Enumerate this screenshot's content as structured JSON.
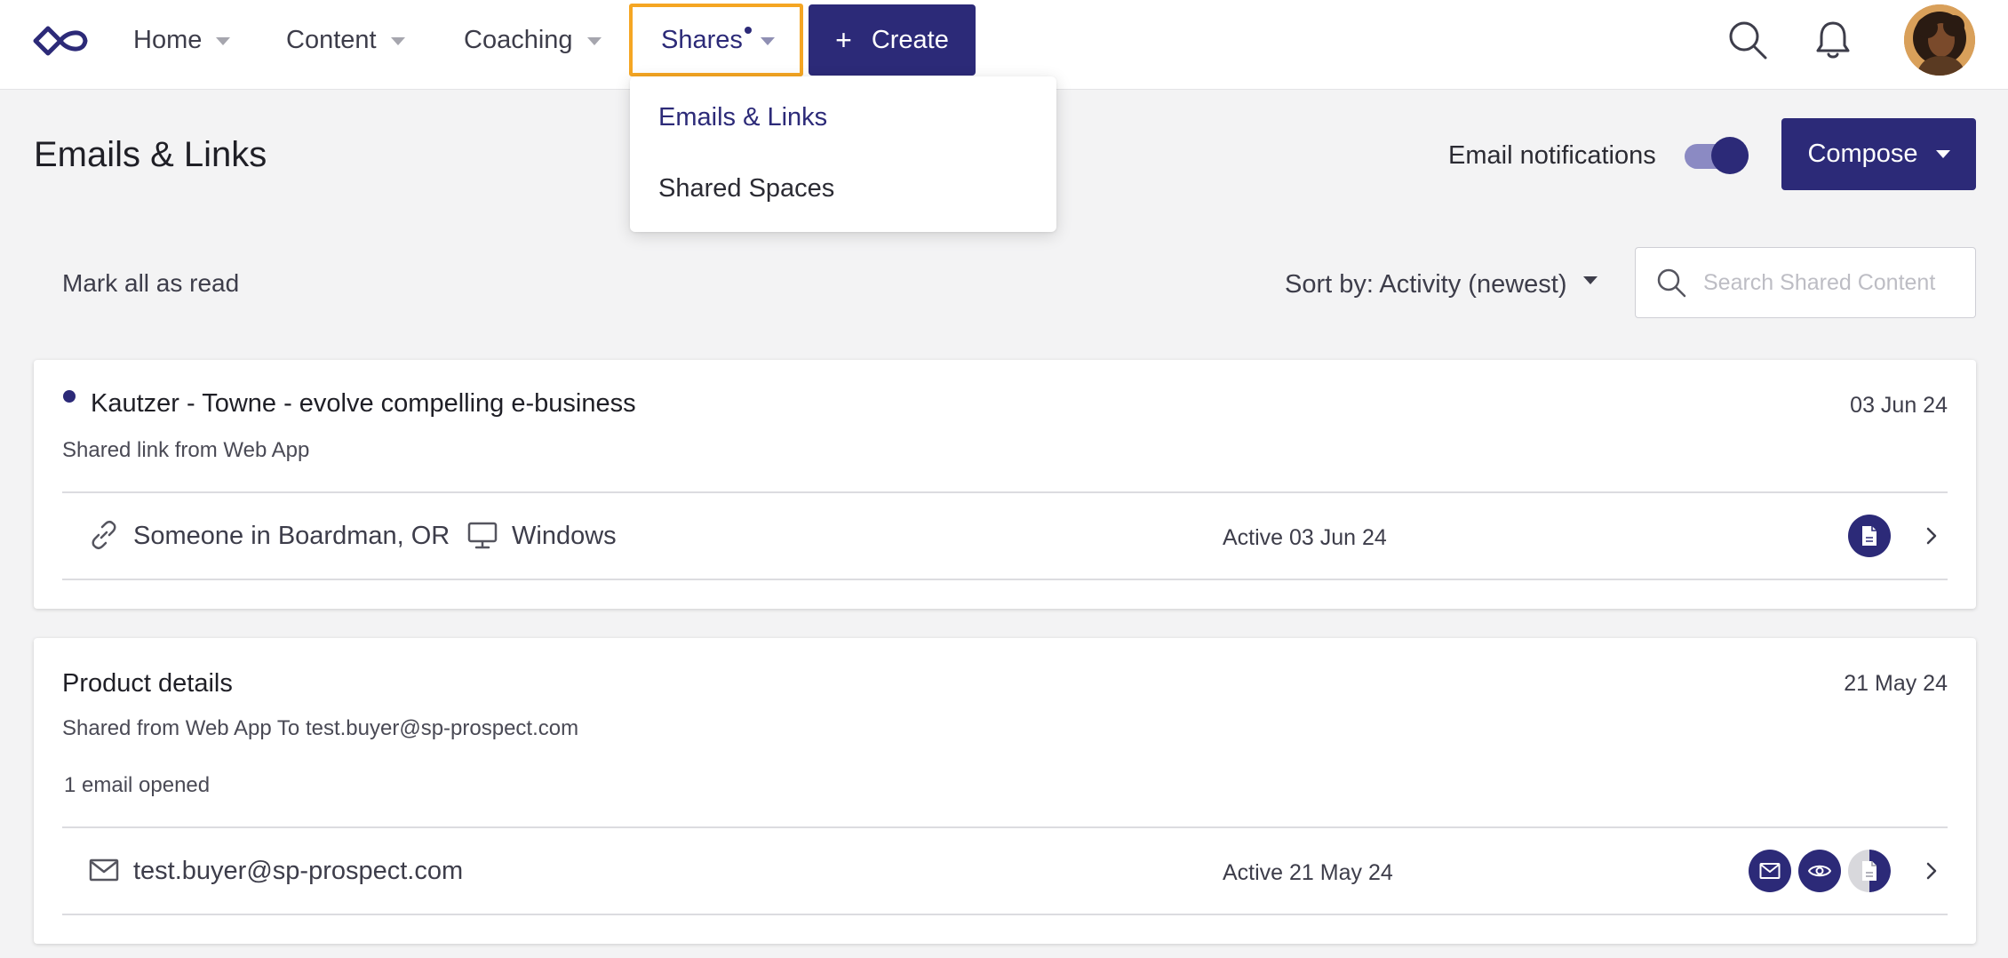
{
  "nav": {
    "home": "Home",
    "content": "Content",
    "coaching": "Coaching",
    "shares": "Shares",
    "create": "Create",
    "create_plus": "+"
  },
  "shares_menu": {
    "items": [
      {
        "label": "Emails & Links",
        "active": true
      },
      {
        "label": "Shared Spaces",
        "active": false
      }
    ]
  },
  "page": {
    "title": "Emails & Links",
    "email_notifications_label": "Email notifications",
    "email_notifications_on": true,
    "compose_label": "Compose"
  },
  "toolbar": {
    "mark_all_read": "Mark all as read",
    "sort_by": "Sort by: Activity (newest)",
    "search_placeholder": "Search Shared Content"
  },
  "shares": [
    {
      "title": "Kautzer - Towne - evolve compelling e-business",
      "unread": true,
      "date": "03 Jun 24",
      "subtitle": "Shared link from Web App",
      "row": {
        "recipient": "Someone in Boardman, OR",
        "device": "Windows",
        "active": "Active 03 Jun 24"
      }
    },
    {
      "title": "Product details",
      "unread": false,
      "date": "21 May 24",
      "subtitle": "Shared from Web App To test.buyer@sp-prospect.com",
      "stat": "1 email opened",
      "row": {
        "recipient": "test.buyer@sp-prospect.com",
        "active": "Active 21 May 24"
      }
    }
  ],
  "colors": {
    "brand": "#2c2a78",
    "highlight": "#f5a623",
    "toggle_track": "#8b8ac3"
  }
}
